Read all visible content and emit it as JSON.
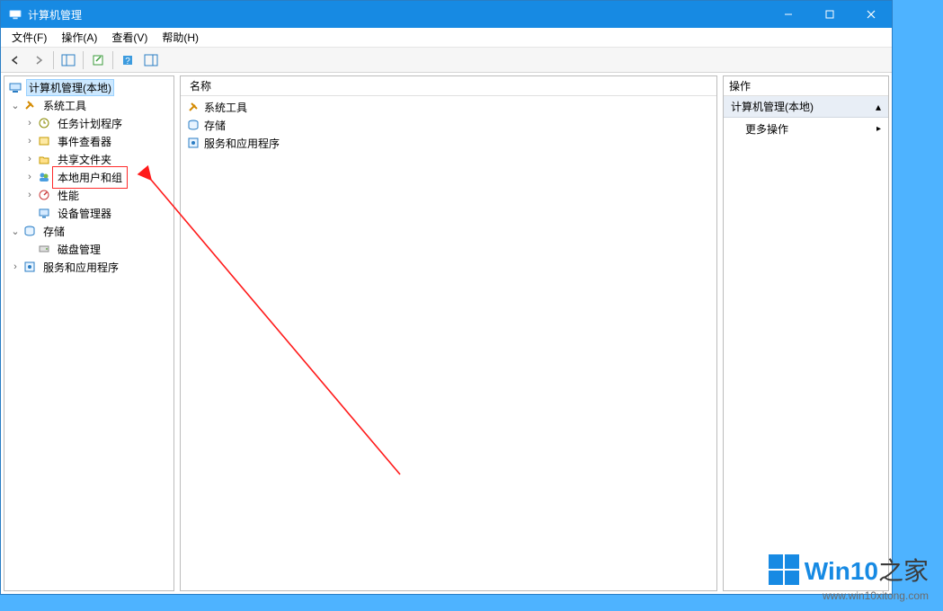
{
  "titlebar": {
    "title": "计算机管理"
  },
  "menu": {
    "file": "文件(F)",
    "action": "操作(A)",
    "view": "查看(V)",
    "help": "帮助(H)"
  },
  "tree": {
    "root": "计算机管理(本地)",
    "system_tools": "系统工具",
    "task_scheduler": "任务计划程序",
    "event_viewer": "事件查看器",
    "shared_folders": "共享文件夹",
    "local_users": "本地用户和组",
    "performance": "性能",
    "device_manager": "设备管理器",
    "storage": "存储",
    "disk_management": "磁盘管理",
    "services_apps": "服务和应用程序"
  },
  "center": {
    "column_name": "名称",
    "items": {
      "system_tools": "系统工具",
      "storage": "存储",
      "services_apps": "服务和应用程序"
    }
  },
  "actions": {
    "header": "操作",
    "section": "计算机管理(本地)",
    "more": "更多操作"
  },
  "watermark": {
    "brand_prefix": "Win10",
    "brand_suffix": "之家",
    "url": "www.win10xitong.com"
  }
}
